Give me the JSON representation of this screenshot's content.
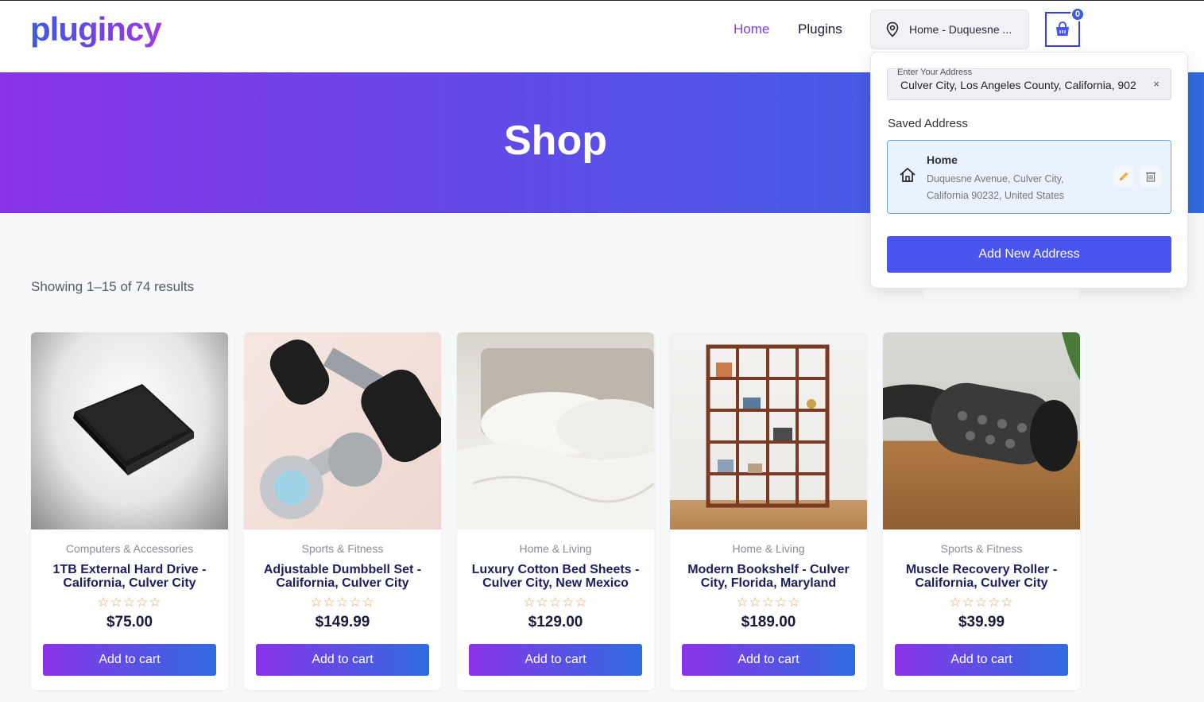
{
  "header": {
    "logo_text": "plugincy",
    "nav": [
      {
        "label": "Home",
        "active": true
      },
      {
        "label": "Plugins",
        "active": false
      }
    ],
    "location_button_label": "Home - Duquesne ...",
    "cart_count": "0"
  },
  "hero": {
    "title": "Shop"
  },
  "shop": {
    "results_text": "Showing 1–15 of 74 results"
  },
  "products": [
    {
      "category": "Computers & Accessories",
      "title": "1TB External Hard Drive - California, Culver City",
      "price": "$75.00",
      "stars": "☆☆☆☆☆",
      "button": "Add to cart",
      "rating": 0,
      "image_icon": "hard-drive-image"
    },
    {
      "category": "Sports & Fitness",
      "title": "Adjustable Dumbbell Set - California, Culver City",
      "price": "$149.99",
      "stars": "☆☆☆☆☆",
      "button": "Add to cart",
      "rating": 0,
      "image_icon": "dumbbell-image"
    },
    {
      "category": "Home & Living",
      "title": "Luxury Cotton Bed Sheets - Culver City, New Mexico",
      "price": "$129.00",
      "stars": "☆☆☆☆☆",
      "button": "Add to cart",
      "rating": 0,
      "image_icon": "bed-sheets-image"
    },
    {
      "category": "Home & Living",
      "title": "Modern Bookshelf - Culver City, Florida, Maryland",
      "price": "$189.00",
      "stars": "☆☆☆☆☆",
      "button": "Add to cart",
      "rating": 0,
      "image_icon": "bookshelf-image"
    },
    {
      "category": "Sports & Fitness",
      "title": "Muscle Recovery Roller - California, Culver City",
      "price": "$39.99",
      "stars": "☆☆☆☆☆",
      "button": "Add to cart",
      "rating": 0,
      "image_icon": "foam-roller-image"
    }
  ],
  "address_popover": {
    "input_label": "Enter Your Address",
    "input_value": "Culver City, Los Angeles County, California, 902",
    "clear_icon": "×",
    "saved_title": "Saved Address",
    "saved": {
      "name": "Home",
      "line1": "Duquesne Avenue, Culver City,",
      "line2": "California 90232, United States"
    },
    "add_button": "Add New Address"
  },
  "colors": {
    "accent_purple": "#7b3fe4",
    "accent_blue": "#2f6be0",
    "button_blue": "#4a55f0",
    "star": "#e8a552"
  }
}
